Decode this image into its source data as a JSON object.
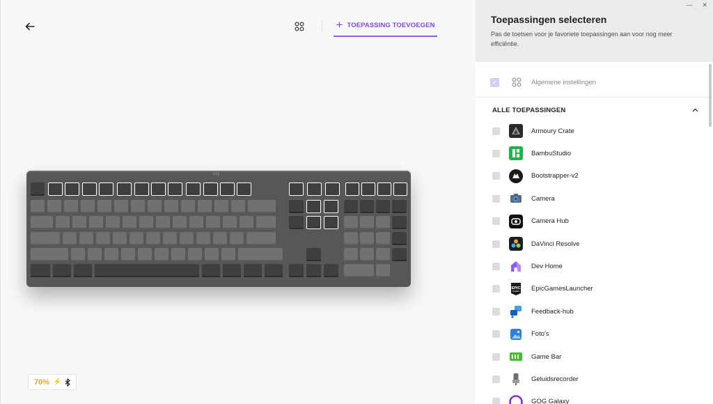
{
  "header": {
    "add_app_label": "TOEPASSING TOEVOEGEN"
  },
  "keyboard": {
    "brand": "logi"
  },
  "battery": {
    "percent": "70%"
  },
  "panel": {
    "title": "Toepassingen selecteren",
    "description": "Pas de toetsen voor je favoriete toepassingen aan voor nog meer efficiëntie.",
    "general_label": "Algemene instellingen",
    "all_apps_header": "ALLE TOEPASSINGEN",
    "apps": [
      {
        "label": "Armoury Crate",
        "icon": "armoury-crate-icon"
      },
      {
        "label": "BambuStudio",
        "icon": "bambustudio-icon"
      },
      {
        "label": "Bootstrapper-v2",
        "icon": "bootstrapper-icon"
      },
      {
        "label": "Camera",
        "icon": "camera-icon"
      },
      {
        "label": "Camera Hub",
        "icon": "camera-hub-icon"
      },
      {
        "label": "DaVinci Resolve",
        "icon": "davinci-resolve-icon"
      },
      {
        "label": "Dev Home",
        "icon": "dev-home-icon"
      },
      {
        "label": "EpicGamesLauncher",
        "icon": "epic-games-icon"
      },
      {
        "label": "Feedback-hub",
        "icon": "feedback-hub-icon"
      },
      {
        "label": "Foto's",
        "icon": "photos-icon"
      },
      {
        "label": "Game Bar",
        "icon": "game-bar-icon"
      },
      {
        "label": "Geluidsrecorder",
        "icon": "sound-recorder-icon"
      },
      {
        "label": "GOG Galaxy",
        "icon": "gog-galaxy-icon"
      }
    ]
  },
  "colors": {
    "accent": "#7a4be8",
    "battery": "#e8a32a"
  }
}
